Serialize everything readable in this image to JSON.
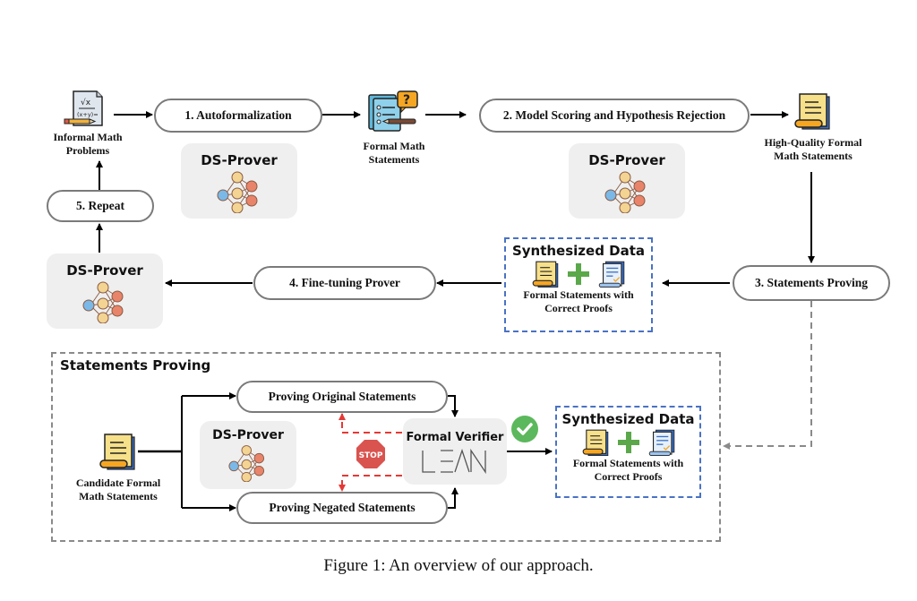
{
  "figure": {
    "caption": "Figure 1: An overview of our approach."
  },
  "pipeline": {
    "inputs": {
      "informal": "Informal Math Problems",
      "formal": "Formal Math Statements",
      "high_quality": "High-Quality Formal Math Statements"
    },
    "steps": [
      {
        "label": "1. Autoformalization"
      },
      {
        "label": "2. Model Scoring and Hypothesis Rejection"
      },
      {
        "label": "3. Statements Proving"
      },
      {
        "label": "4. Fine-tuning Prover"
      },
      {
        "label": "5. Repeat"
      }
    ],
    "prover_label": "DS-Prover",
    "synthesized": {
      "title": "Synthesized Data",
      "caption_line1": "Formal Statements with",
      "caption_line2": "Correct Proofs"
    }
  },
  "detail": {
    "title": "Statements Proving",
    "candidate": "Candidate Formal Math Statements",
    "proving_original": "Proving Original Statements",
    "proving_negated": "Proving Negated Statements",
    "verifier_title": "Formal Verifier",
    "verifier_logo": "LEAN",
    "stop_text": "STOP"
  },
  "colors": {
    "synth_border": "#4a72c4",
    "stop_red": "#d9534f",
    "check_green": "#5cb85c",
    "dashed_red": "#e53935",
    "plus_green": "#5aa84a"
  }
}
